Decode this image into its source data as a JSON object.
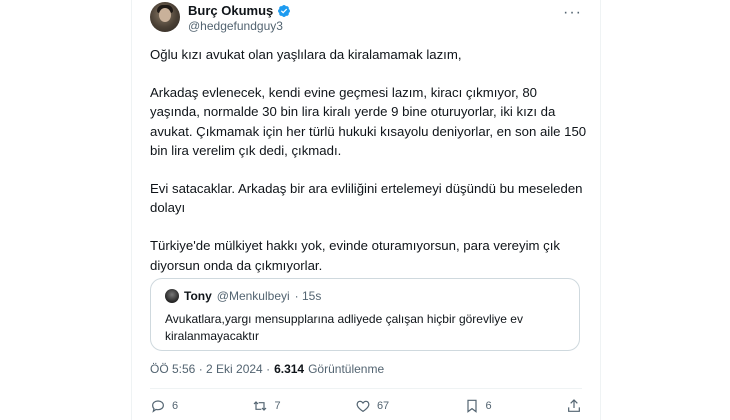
{
  "tweet": {
    "author_name": "Burç Okumuş",
    "author_handle": "@hedgefundguy3",
    "more_label": "···",
    "paragraphs": [
      "Oğlu kızı avukat olan yaşlılara da kiralamamak lazım,",
      "Arkadaş evlenecek, kendi evine geçmesi lazım, kiracı çıkmıyor, 80 yaşında, normalde 30 bin lira kiralı yerde 9 bine oturuyorlar, iki kızı da avukat. Çıkmamak için her türlü hukuki kısayolu deniyorlar, en son aile 150 bin lira verelim çık dedi, çıkmadı.",
      "Evi satacaklar. Arkadaş bir ara evliliğini ertelemeyi düşündü bu meseleden dolayı",
      "Türkiye'de mülkiyet hakkı yok, evinde oturamıyorsun, para vereyim çık diyorsun onda da çıkmıyorlar."
    ],
    "timestamp": "ÖÖ 5:56 · 2 Eki 2024 ·",
    "views_count": "6.314",
    "views_label": "Görüntülenme"
  },
  "quote": {
    "name": "Tony",
    "handle": "@Menkulbeyi",
    "time": "· 15s",
    "text": "Avukatlara,yargı mensupplarına adliyede çalışan hiçbir görevliye ev kiralanmayacaktır"
  },
  "actions": {
    "replies": "6",
    "retweets": "7",
    "likes": "67",
    "bookmarks": "6"
  },
  "colors": {
    "verified": "#1d9bf0",
    "secondary_text": "#536471",
    "border": "#cfd9de"
  }
}
